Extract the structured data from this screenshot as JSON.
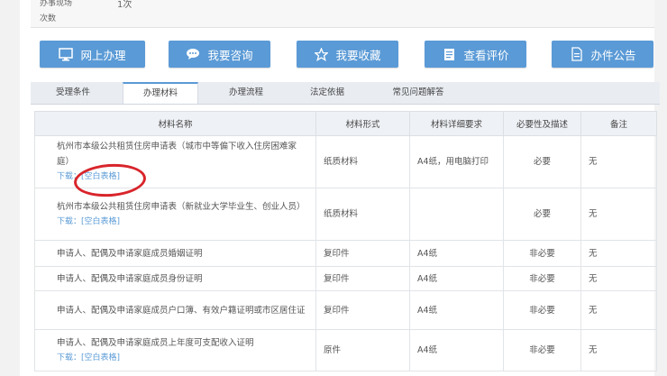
{
  "top_info": {
    "label": "办事现场次数",
    "value": "1次"
  },
  "buttons": [
    {
      "label": "网上办理",
      "icon": "monitor-icon"
    },
    {
      "label": "我要咨询",
      "icon": "chat-bubble-icon"
    },
    {
      "label": "我要收藏",
      "icon": "star-icon"
    },
    {
      "label": "查看评价",
      "icon": "document-icon"
    },
    {
      "label": "办件公告",
      "icon": "notice-icon"
    }
  ],
  "tabs": [
    "受理条件",
    "办理材料",
    "办理流程",
    "法定依据",
    "常见问题解答"
  ],
  "table": {
    "headers": [
      "材料名称",
      "材料形式",
      "材料详细要求",
      "必要性及描述",
      "备注"
    ],
    "download_label": "下载：",
    "download_link": "[空白表格]",
    "rows": [
      {
        "name": "杭州市本级公共租赁住房申请表（城市中等偏下收入住房困难家庭）",
        "form": "纸质材料",
        "req": "A4纸，用电脑打印",
        "necessity": "必要",
        "note": "无",
        "download": true
      },
      {
        "name": "杭州市本级公共租赁住房申请表（新就业大学毕业生、创业人员）",
        "form": "纸质材料",
        "req": "",
        "necessity": "必要",
        "note": "无",
        "download": true
      },
      {
        "name": "申请人、配偶及申请家庭成员婚姻证明",
        "form": "复印件",
        "req": "A4纸",
        "necessity": "非必要",
        "note": "无",
        "download": false
      },
      {
        "name": "申请人、配偶及申请家庭成员身份证明",
        "form": "复印件",
        "req": "A4纸",
        "necessity": "非必要",
        "note": "无",
        "download": false
      },
      {
        "name": "申请人、配偶及申请家庭成员户口簿、有效户籍证明或市区居住证",
        "form": "复印件",
        "req": "A4纸",
        "necessity": "非必要",
        "note": "无",
        "download": false
      },
      {
        "name": "申请人、配偶及申请家庭成员上年度可支配收入证明",
        "form": "原件",
        "req": "A4纸",
        "necessity": "非必要",
        "note": "无",
        "download": true
      }
    ]
  },
  "colors": {
    "accent": "#5a9ad6",
    "annotation_circle": "#d8252b"
  }
}
